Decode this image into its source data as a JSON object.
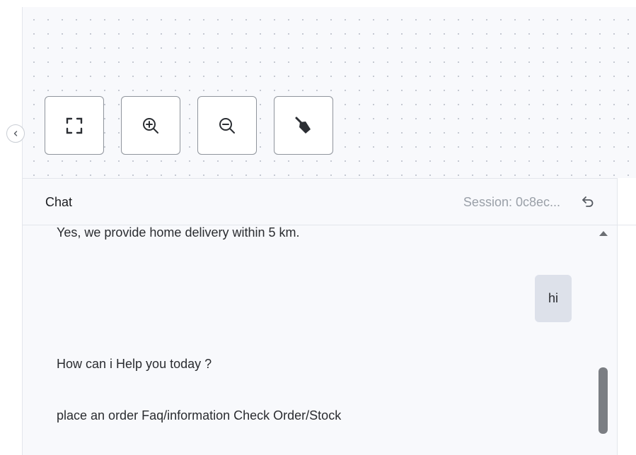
{
  "canvas": {
    "controls": [
      {
        "name": "fit-view",
        "icon": "expand-corners-icon"
      },
      {
        "name": "zoom-in",
        "icon": "zoom-in-icon"
      },
      {
        "name": "zoom-out",
        "icon": "zoom-out-icon"
      },
      {
        "name": "clean",
        "icon": "broom-icon"
      }
    ],
    "collapse_icon": "chevron-left-icon"
  },
  "chat": {
    "title": "Chat",
    "session": "Session: 0c8ec...",
    "undo_icon": "undo-arrow-icon",
    "messages": [
      {
        "role": "bot",
        "text": "Yes, we provide home delivery within 5 km."
      },
      {
        "role": "user",
        "text": "hi"
      },
      {
        "role": "bot",
        "text": "How can i Help you today ?"
      },
      {
        "role": "bot",
        "text": "place an order Faq/information Check Order/Stock"
      }
    ]
  },
  "colors": {
    "panel_bg": "#f8f9fc",
    "user_bubble": "#dde1ea",
    "border": "#e3e6ec",
    "scroll_thumb": "#7b7e83"
  }
}
